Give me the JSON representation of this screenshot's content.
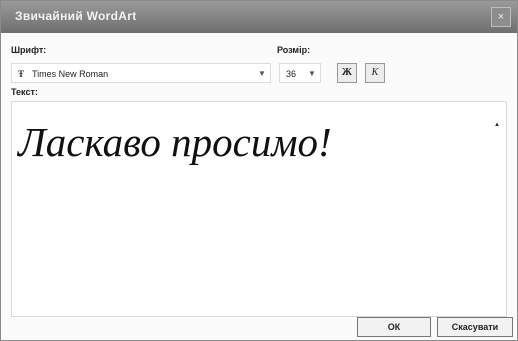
{
  "dialog": {
    "title": "Звичайний WordArt",
    "close_label": "×"
  },
  "font": {
    "label": "Шрифт:",
    "value": "Times New Roman",
    "icon": "truetype-font-icon",
    "icon_glyph": "Ŧ"
  },
  "size": {
    "label": "Розмір:",
    "value": "36"
  },
  "format": {
    "bold_label": "Ж",
    "italic_label": "К"
  },
  "text": {
    "label": "Текст:",
    "value": "Ласкаво просимо!"
  },
  "buttons": {
    "ok_label": "ОК",
    "cancel_label": "Скасувати"
  }
}
